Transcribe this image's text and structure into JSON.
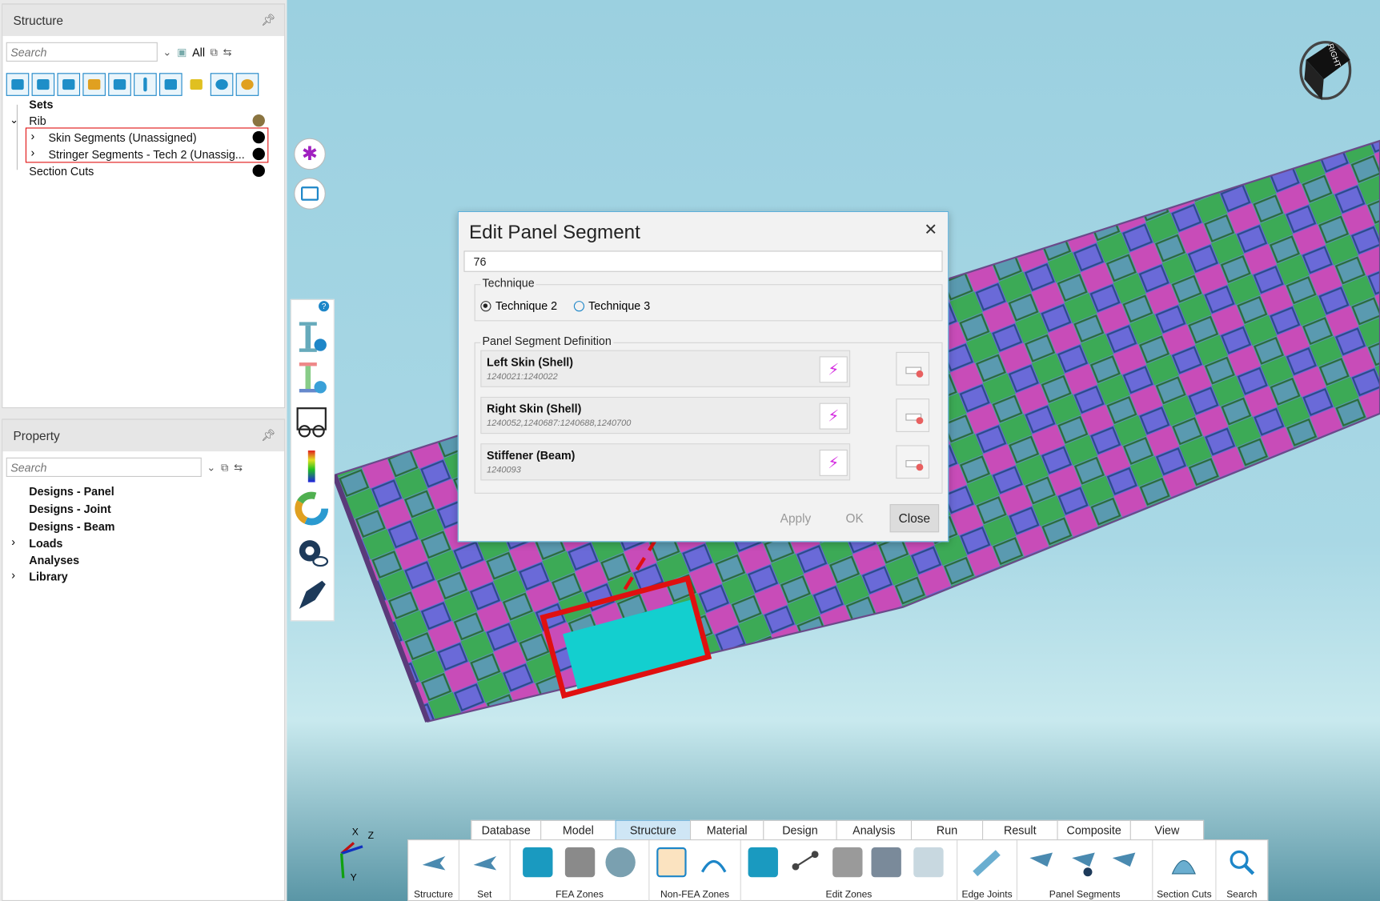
{
  "structure_panel": {
    "title": "Structure",
    "search_placeholder": "Search",
    "filter_label": "All",
    "tree": {
      "sets": "Sets",
      "rib": "Rib",
      "skin_segments": "Skin Segments (Unassigned)",
      "stringer_segments": "Stringer Segments - Tech 2 (Unassig...",
      "section_cuts": "Section Cuts"
    },
    "toolbar_icons": [
      "connector-icon",
      "solid-icon",
      "shell-icon",
      "joint-icon",
      "plate-icon",
      "beam-icon",
      "block-icon",
      "layers-icon",
      "lens-icon",
      "gear-chip-icon"
    ]
  },
  "property_panel": {
    "title": "Property",
    "search_placeholder": "Search",
    "items": [
      "Designs - Panel",
      "Designs - Joint",
      "Designs - Beam",
      "Loads",
      "Analyses",
      "Library"
    ]
  },
  "dialog": {
    "title": "Edit Panel Segment",
    "id_value": "76",
    "technique_label": "Technique",
    "technique_options": [
      "Technique 2",
      "Technique 3"
    ],
    "selected_technique": "Technique 2",
    "definition_label": "Panel Segment Definition",
    "rows": [
      {
        "name": "Left Skin (Shell)",
        "ids": "1240021:1240022"
      },
      {
        "name": "Right Skin (Shell)",
        "ids": "1240052,1240687:1240688,1240700"
      },
      {
        "name": "Stiffener (Beam)",
        "ids": "1240093"
      }
    ],
    "buttons": {
      "apply": "Apply",
      "ok": "OK",
      "close": "Close"
    }
  },
  "ribbon": {
    "tabs": [
      "Database",
      "Model",
      "Structure",
      "Material",
      "Design",
      "Analysis",
      "Run",
      "Result",
      "Composite",
      "View"
    ],
    "active_tab": "Structure",
    "groups": [
      "Structure",
      "Set",
      "FEA Zones",
      "Non-FEA Zones",
      "Edit Zones",
      "Edge Joints",
      "Panel Segments",
      "Section Cuts",
      "Search"
    ]
  },
  "viewcube_label": "RIGHT",
  "axis_labels": {
    "x": "X",
    "y": "Y",
    "z": "Z"
  },
  "colors": {
    "accent": "#1d86c8",
    "highlight_box": "#e01010",
    "bolt": "#d42be0"
  }
}
